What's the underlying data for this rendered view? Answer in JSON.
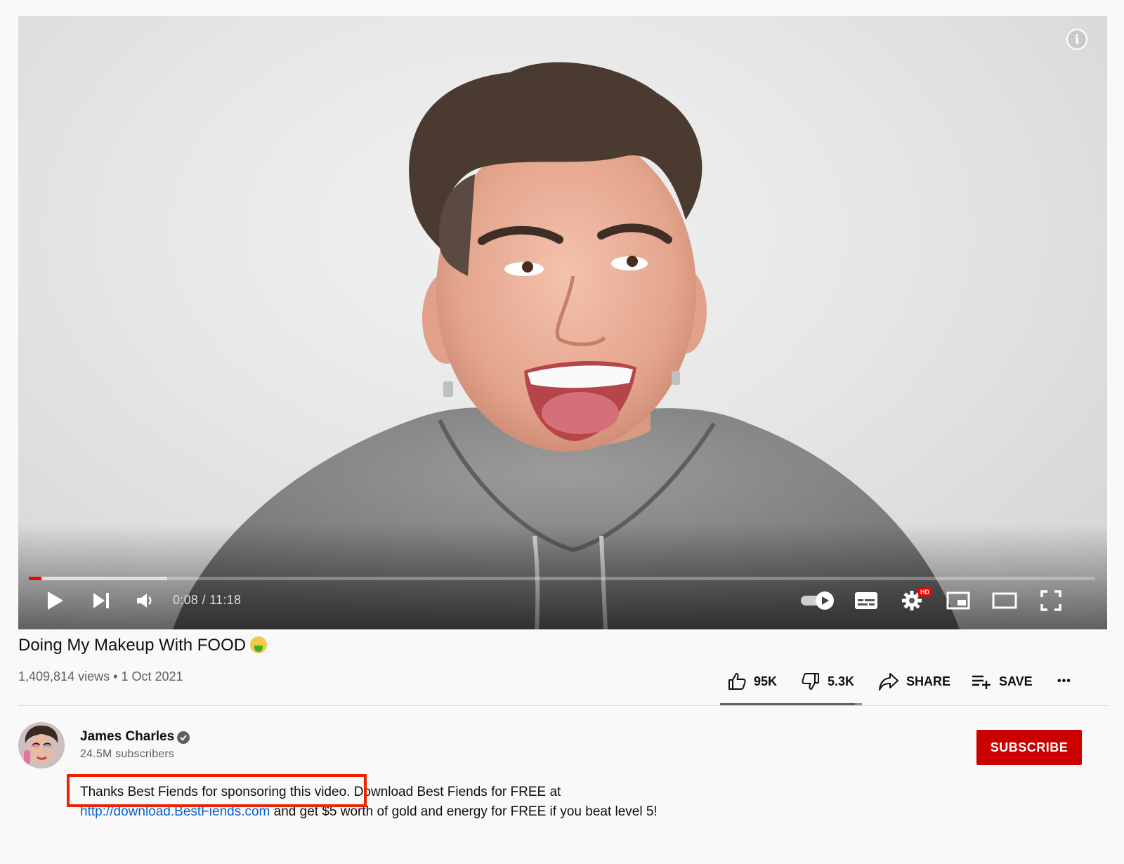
{
  "player": {
    "current_time": "0:08",
    "duration": "11:18",
    "time_display": "0:08 / 11:18",
    "played_fraction": 0.012,
    "buffered_fraction": 0.13,
    "settings_badge": "HD",
    "info_glyph": "i",
    "icons": [
      "play-icon",
      "next-icon",
      "volume-icon",
      "autoplay-toggle-icon",
      "subtitles-icon",
      "settings-icon",
      "miniplayer-icon",
      "theater-mode-icon",
      "fullscreen-icon"
    ]
  },
  "video": {
    "title": "Doing My Makeup With FOOD",
    "title_emoji_icon": "nauseated-face-icon",
    "views": "1,409,814 views",
    "separator": "•",
    "date": "1 Oct 2021"
  },
  "actions": {
    "likes": "95K",
    "dislikes": "5.3K",
    "share_label": "SHARE",
    "save_label": "SAVE",
    "more_glyph": "•••",
    "like_fraction": 0.95
  },
  "channel": {
    "name": "James Charles",
    "verified_icon": "verified-check-icon",
    "subscribers": "24.5M subscribers",
    "subscribe_label": "SUBSCRIBE"
  },
  "description": {
    "line1": "Thanks Best Fiends for sponsoring this video. Download Best Fiends for FREE at",
    "link": "http://download.BestFiends.com",
    "line2": " and get $5 worth of gold and energy for FREE if you beat level 5!"
  },
  "colors": {
    "accent_red": "#ff0000",
    "subscribe_bg": "#cc0000",
    "link": "#065fd4",
    "highlight_box": "#ee2200"
  }
}
